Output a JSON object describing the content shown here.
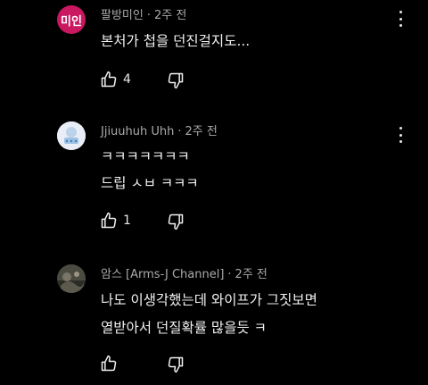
{
  "comments": [
    {
      "avatar_text": "미인",
      "author": "팔방미인",
      "separator": "·",
      "time": "2주 전",
      "lines": [
        "본처가 첩을 던진걸지도..."
      ],
      "likes": "4",
      "avatar_color": "#c9185f"
    },
    {
      "author": "Jjiuuhuh Uhh",
      "separator": "·",
      "time": "2주 전",
      "lines": [
        "ㅋㅋㅋㅋㅋㅋㅋ",
        "드립 ㅅㅂ ㅋㅋㅋ"
      ],
      "likes": "1"
    },
    {
      "author": "암스 [Arms-J Channel]",
      "separator": "·",
      "time": "2주 전",
      "lines": [
        "나도 이생각했는데 와이프가 그짓보면",
        "열받아서 던질확률 많을듯 ㅋ"
      ],
      "likes": ""
    }
  ],
  "icons": {
    "like": "thumbs-up-icon",
    "dislike": "thumbs-down-icon",
    "menu": "more-vert-icon"
  }
}
